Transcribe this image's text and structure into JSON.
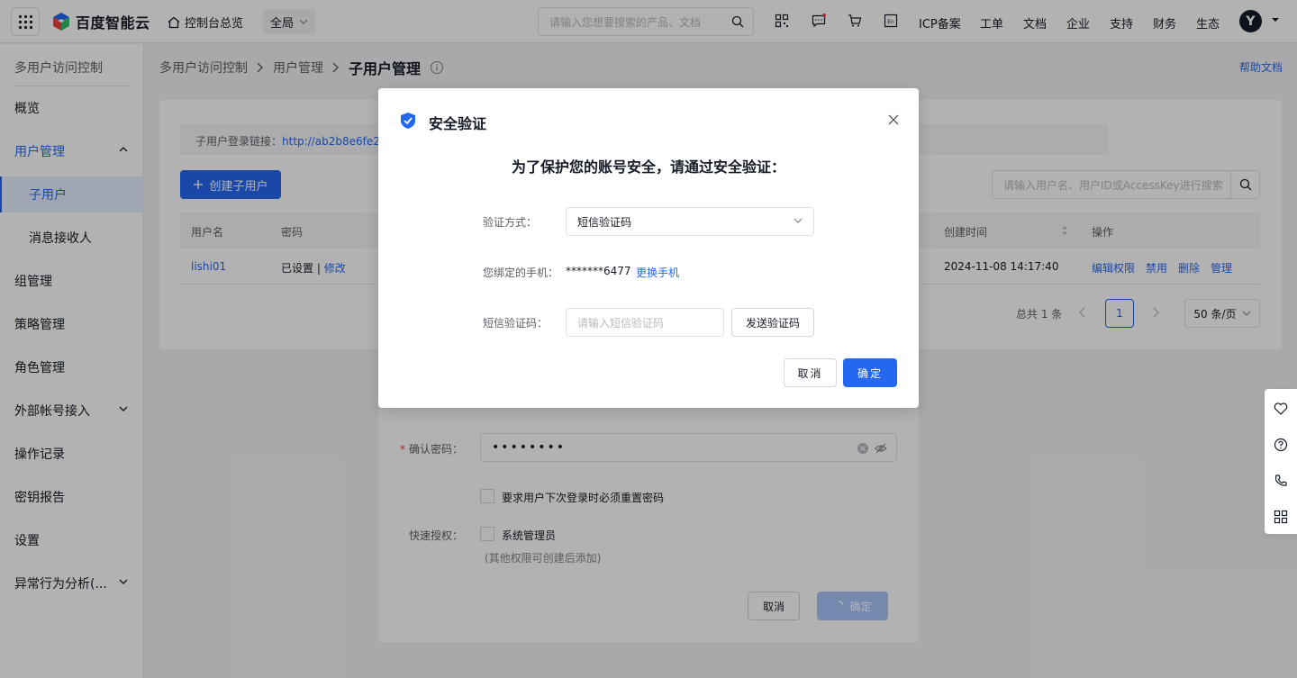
{
  "topbar": {
    "logo_text": "百度智能云",
    "console_label": "控制台总览",
    "region_label": "全局",
    "search_placeholder": "请输入您想要搜索的产品、文档",
    "nav": [
      "ICP备案",
      "工单",
      "文档",
      "企业",
      "支持",
      "财务",
      "生态"
    ],
    "avatar_letter": "Y"
  },
  "sidebar": {
    "title": "多用户访问控制",
    "items": [
      "概览",
      "用户管理",
      "子用户",
      "消息接收人",
      "组管理",
      "策略管理",
      "角色管理",
      "外部帐号接入",
      "操作记录",
      "密钥报告",
      "设置",
      "异常行为分析(..."
    ]
  },
  "breadcrumb": [
    "多用户访问控制",
    "用户管理",
    "子用户管理"
  ],
  "help_label": "帮助文档",
  "login_link": {
    "label": "子用户登录链接：",
    "url": "http://ab2b8e6fe2a"
  },
  "create_button": "创建子用户",
  "user_search_placeholder": "请输入用户名、用户ID或AccessKey进行搜索",
  "table": {
    "headers": [
      "用户名",
      "密码",
      "创建时间",
      "操作"
    ],
    "row": {
      "username": "lishi01",
      "password_status": "已设置",
      "separator": "|",
      "modify": "修改",
      "created": "2024-11-08 14:17:40",
      "actions": [
        "编辑权限",
        "禁用",
        "删除",
        "管理"
      ]
    }
  },
  "pager": {
    "total": "总共 1 条",
    "page": "1",
    "size": "50 条/页"
  },
  "drawer": {
    "confirm_password_label": "确认密码：",
    "password_mask": "••••••••",
    "reset_option": "要求用户下次登录时必须重置密码",
    "quick_auth_label": "快速授权：",
    "admin_option": "系统管理员",
    "hint": "(其他权限可创建后添加)",
    "cancel": "取消",
    "ok": "确定"
  },
  "modal": {
    "title": "安全验证",
    "heading": "为了保护您的账号安全，请通过安全验证：",
    "method_label": "验证方式：",
    "method_value": "短信验证码",
    "phone_label": "您绑定的手机：",
    "phone_value": "*******6477",
    "change_phone": "更换手机",
    "code_label": "短信验证码：",
    "code_placeholder": "请输入短信验证码",
    "send_code": "发送验证码",
    "cancel": "取消",
    "ok": "确定"
  },
  "colors": {
    "primary": "#2468f2",
    "text": "#151b26",
    "secondary_text": "#5c5f66"
  }
}
